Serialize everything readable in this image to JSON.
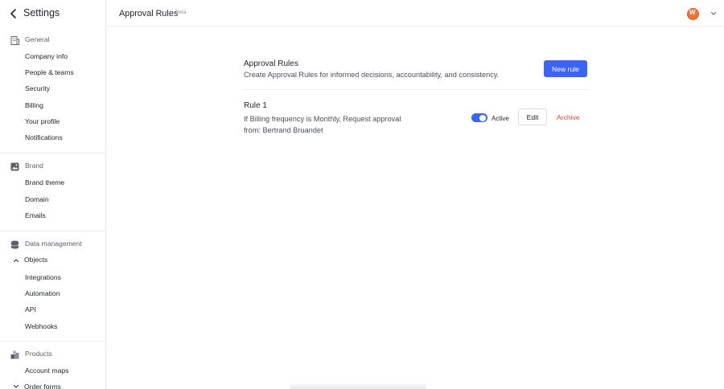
{
  "settings_header": {
    "title": "Settings"
  },
  "sidebar": {
    "general": {
      "label": "General",
      "items": [
        "Company info",
        "People & teams",
        "Security",
        "Billing",
        "Your profile",
        "Notifications"
      ]
    },
    "brand": {
      "label": "Brand",
      "items": [
        "Brand theme",
        "Domain",
        "Emails"
      ]
    },
    "data_management": {
      "label": "Data management",
      "objects_label": "Objects",
      "items": [
        "Integrations",
        "Automation",
        "API",
        "Webhooks"
      ]
    },
    "products": {
      "label": "Products",
      "items": [
        "Account maps"
      ],
      "order_forms_label": "Order forms"
    }
  },
  "topbar": {
    "title": "Approval Rules",
    "badge": "Beta",
    "avatar_letter": "W",
    "avatar_color": "#f1733a"
  },
  "main": {
    "title": "Approval Rules",
    "description": "Create Approval Rules for informed decisions, accountability, and consistency.",
    "new_rule_label": "New rule",
    "accent_color": "#3d63f2"
  },
  "rule": {
    "title": "Rule 1",
    "description": "If Billing frequency is Monthly, Request approval from: Bertrand Bruandet",
    "active_label": "Active",
    "active": true,
    "edit_label": "Edit",
    "archive_label": "Archive",
    "archive_color": "#d9453b"
  }
}
